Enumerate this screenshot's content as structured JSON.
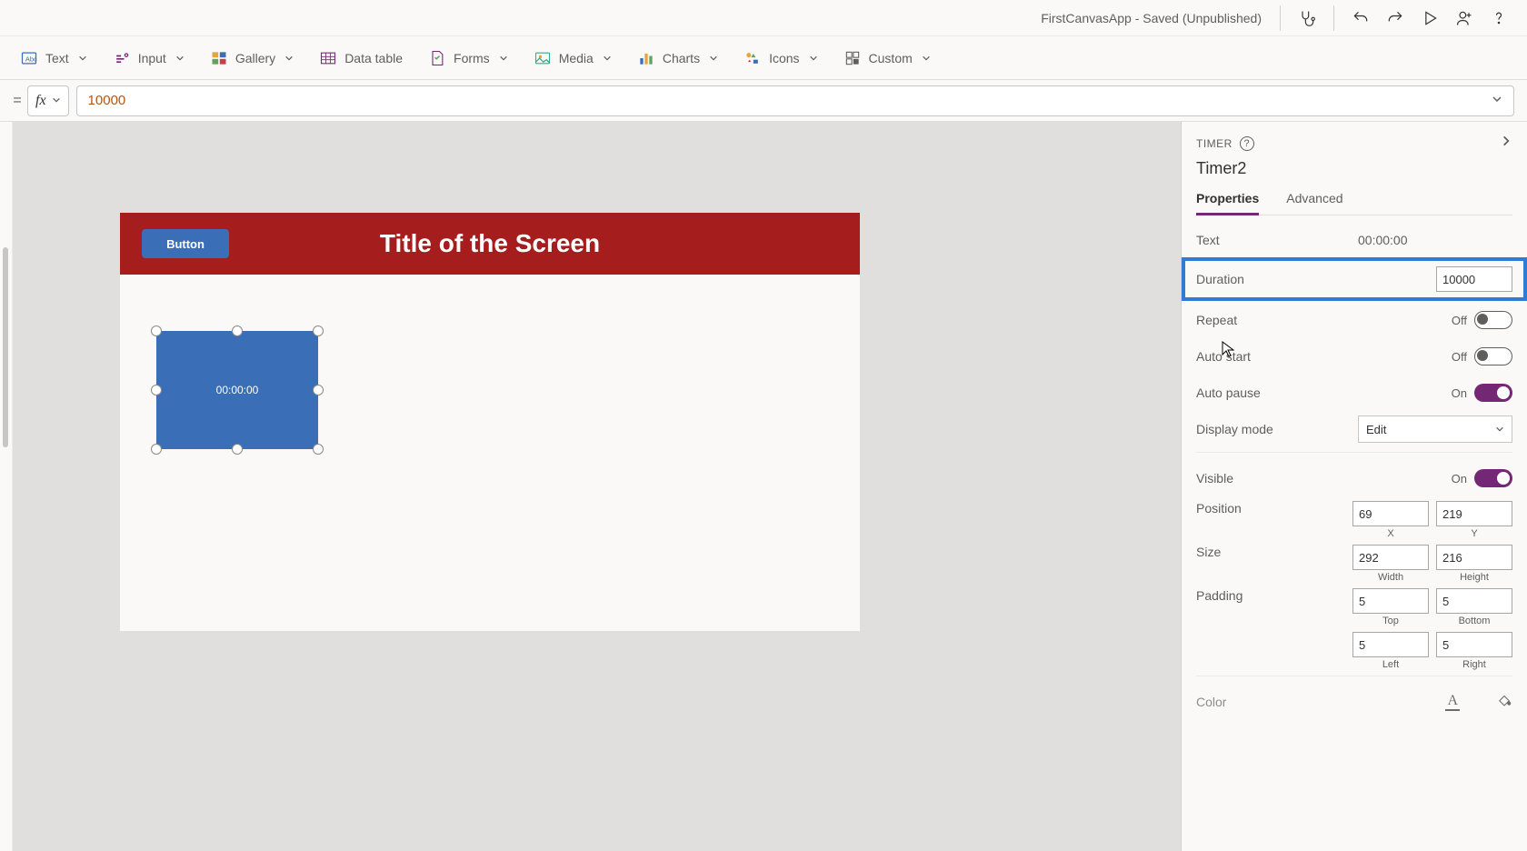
{
  "app_title": "FirstCanvasApp - Saved (Unpublished)",
  "ribbon": {
    "text": "Text",
    "input": "Input",
    "gallery": "Gallery",
    "datatable": "Data table",
    "forms": "Forms",
    "media": "Media",
    "charts": "Charts",
    "icons": "Icons",
    "custom": "Custom"
  },
  "formula": {
    "value": "10000"
  },
  "canvas": {
    "button_label": "Button",
    "screen_title": "Title of the Screen",
    "timer_display": "00:00:00"
  },
  "panel": {
    "type_label": "TIMER",
    "control_name": "Timer2",
    "tab_properties": "Properties",
    "tab_advanced": "Advanced",
    "text_label": "Text",
    "text_value": "00:00:00",
    "duration_label": "Duration",
    "duration_value": "10000",
    "repeat_label": "Repeat",
    "repeat_state": "Off",
    "autostart_label": "Auto start",
    "autostart_state": "Off",
    "autopause_label": "Auto pause",
    "autopause_state": "On",
    "displaymode_label": "Display mode",
    "displaymode_value": "Edit",
    "visible_label": "Visible",
    "visible_state": "On",
    "position_label": "Position",
    "position_x": "69",
    "position_y": "219",
    "x_label": "X",
    "y_label": "Y",
    "size_label": "Size",
    "size_w": "292",
    "size_h": "216",
    "width_label": "Width",
    "height_label": "Height",
    "padding_label": "Padding",
    "padding_top": "5",
    "padding_bottom": "5",
    "padding_left": "5",
    "padding_right": "5",
    "top_label": "Top",
    "bottom_label": "Bottom",
    "left_label": "Left",
    "right_label": "Right",
    "color_label": "Color"
  }
}
